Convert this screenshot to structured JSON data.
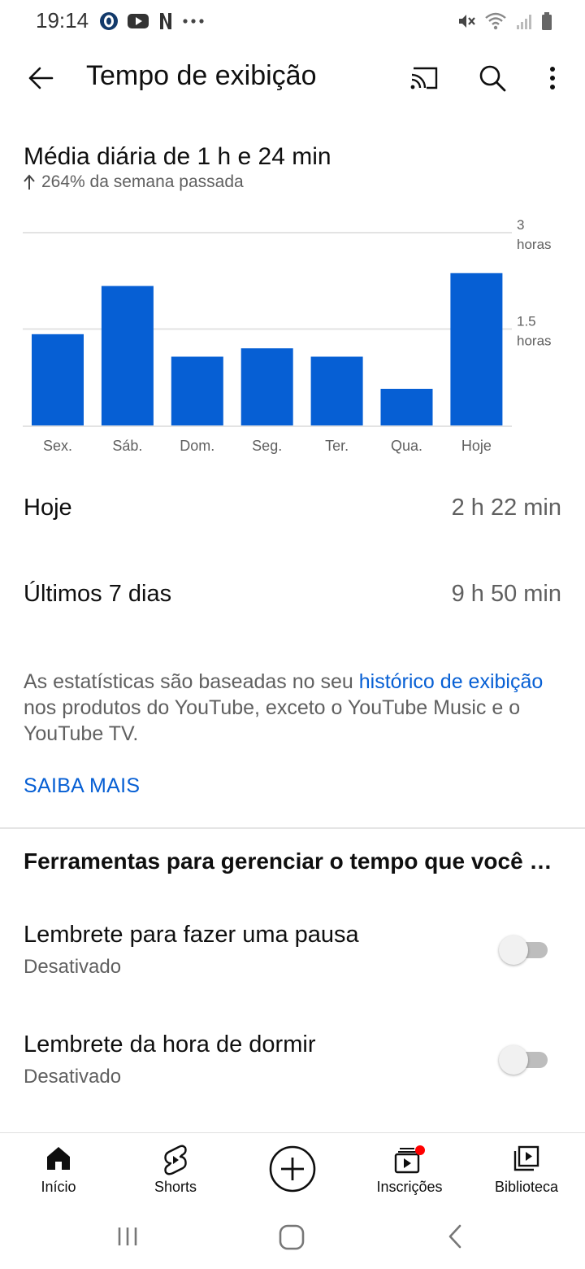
{
  "status": {
    "time": "19:14"
  },
  "appbar": {
    "title": "Tempo de exibição"
  },
  "summary": {
    "average": "Média diária de 1 h e 24 min",
    "trend": "264% da semana passada"
  },
  "chart_data": {
    "type": "bar",
    "categories": [
      "Sex.",
      "Sáb.",
      "Dom.",
      "Seg.",
      "Ter.",
      "Qua.",
      "Hoje"
    ],
    "values": [
      1.42,
      2.17,
      1.07,
      1.2,
      1.07,
      0.57,
      2.37
    ],
    "ylim": [
      0,
      3
    ],
    "yticks": [
      {
        "value": 3,
        "label": [
          "3",
          "horas"
        ]
      },
      {
        "value": 1.5,
        "label": [
          "1.5",
          "horas"
        ]
      }
    ],
    "grid": true,
    "color": "#065fd4"
  },
  "stats": [
    {
      "label": "Hoje",
      "value": "2 h 22 min"
    },
    {
      "label": "Últimos 7 dias",
      "value": "9 h 50 min"
    }
  ],
  "info": {
    "prefix": "As estatísticas são baseadas no seu ",
    "link": "histórico de exibição",
    "suffix": " nos produtos do YouTube, exceto o YouTube Music e o YouTube TV."
  },
  "learn_more": "SAIBA MAIS",
  "tools": {
    "heading": "Ferramentas para gerenciar o tempo que você passa no YouTube",
    "items": [
      {
        "label": "Lembrete para fazer uma pausa",
        "status": "Desativado"
      },
      {
        "label": "Lembrete da hora de dormir",
        "status": "Desativado"
      }
    ]
  },
  "nav": {
    "items": [
      {
        "label": "Início",
        "icon": "home-icon"
      },
      {
        "label": "Shorts",
        "icon": "shorts-icon"
      },
      {
        "label": "",
        "icon": "create-icon"
      },
      {
        "label": "Inscrições",
        "icon": "subscriptions-icon"
      },
      {
        "label": "Biblioteca",
        "icon": "library-icon"
      }
    ]
  },
  "colors": {
    "accent": "#065fd4",
    "notification": "#ff0000"
  }
}
